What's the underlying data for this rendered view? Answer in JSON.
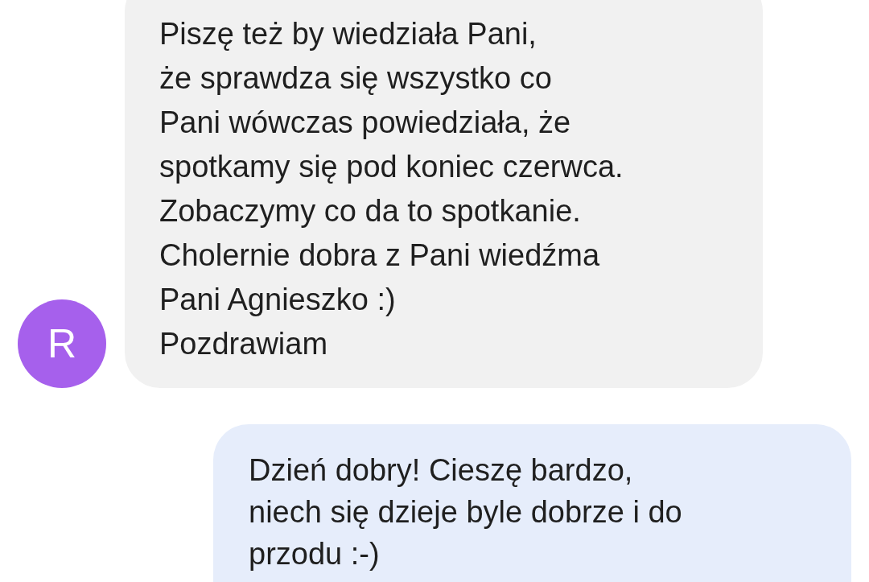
{
  "messages": [
    {
      "kind": "received",
      "avatar": {
        "letter": "R",
        "color": "#a660ec"
      },
      "text": "Piszę też by wiedziała Pani,\nże sprawdza się wszystko co\nPani wówczas powiedziała, że\nspotkamy się pod koniec czerwca.\nZobaczymy co da to spotkanie.\nCholernie dobra z Pani wiedźma\nPani Agnieszko :)\nPozdrawiam"
    },
    {
      "kind": "sent",
      "text": "Dzień dobry! Cieszę bardzo,\nniech się dzieje byle dobrze i do\nprzodu :-)"
    }
  ]
}
